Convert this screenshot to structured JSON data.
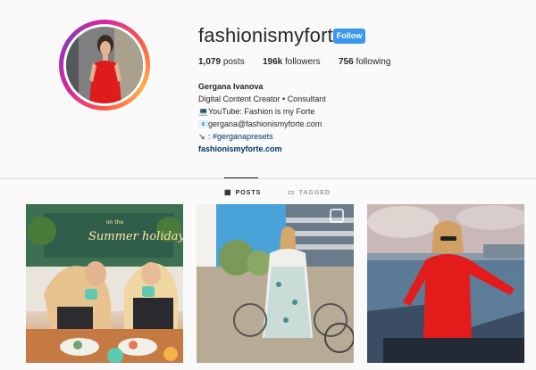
{
  "profile": {
    "username": "fashionismyfortee",
    "follow_label": "Follow",
    "stats": {
      "posts": {
        "count": "1,079",
        "label": "posts"
      },
      "followers": {
        "count": "196k",
        "label": "followers"
      },
      "following": {
        "count": "756",
        "label": "following"
      }
    },
    "bio": {
      "name": "Gergana Ivanova",
      "line1": "Digital Content Creator • Consultant",
      "youtube": "YouTube: Fashion is my Forte",
      "email": "gergana@fashionismyforte.com",
      "hashtag_prefix": ":",
      "hashtag": "#gerganapresets",
      "website": "fashionismyforte.com"
    }
  },
  "tabs": [
    {
      "label": "POSTS",
      "icon": "grid-icon",
      "active": true
    },
    {
      "label": "TAGGED",
      "icon": "tag-icon",
      "active": false
    }
  ],
  "posts": [
    {
      "neon_text": "Summer holidays",
      "sign_small": "on the"
    },
    {
      "icon": "multi-photo-icon"
    },
    {}
  ],
  "colors": {
    "follow_button": "#3897f0",
    "link": "#003569",
    "background": "#fafafa"
  }
}
